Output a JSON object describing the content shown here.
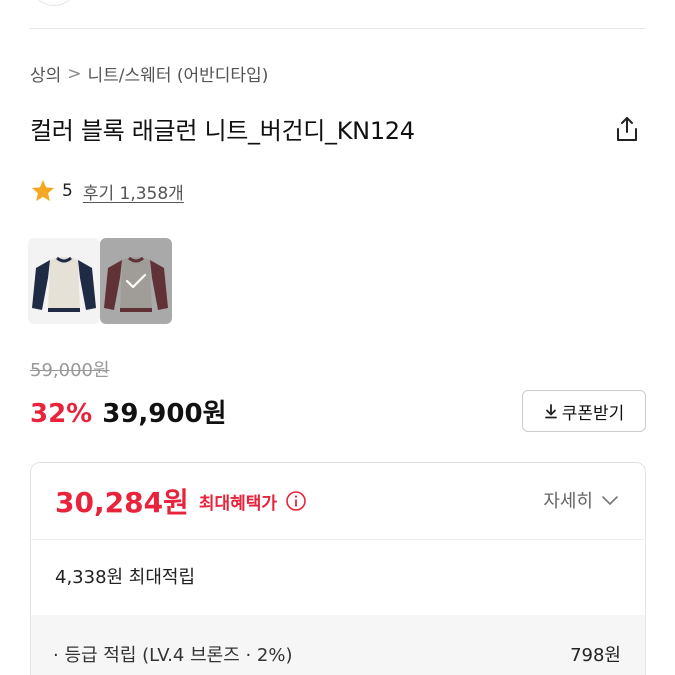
{
  "breadcrumb": {
    "items": [
      "상의",
      "니트/스웨터 (어반디타입)"
    ],
    "separator": ">"
  },
  "product": {
    "title": "컬러 블록 래글런 니트_버건디_KN124"
  },
  "rating": {
    "score": "5",
    "reviews_label": "후기 1,358개",
    "star_color": "#f5a623"
  },
  "thumbnails": [
    {
      "color": "navy",
      "selected": false
    },
    {
      "color": "burgundy",
      "selected": true
    }
  ],
  "price": {
    "original": "59,000원",
    "discount": "32%",
    "sale": "39,900원",
    "accent_color": "#e8233b"
  },
  "coupon": {
    "label": "쿠폰받기",
    "icon": "download-icon"
  },
  "benefit": {
    "max_price": "30,284원",
    "max_label": "최대혜택가",
    "detail_label": "자세히",
    "max_points": "4,338원 최대적립",
    "grade_label": "· 등급 적립 (LV.4 브론즈 · 2%)",
    "grade_value": "798원"
  }
}
